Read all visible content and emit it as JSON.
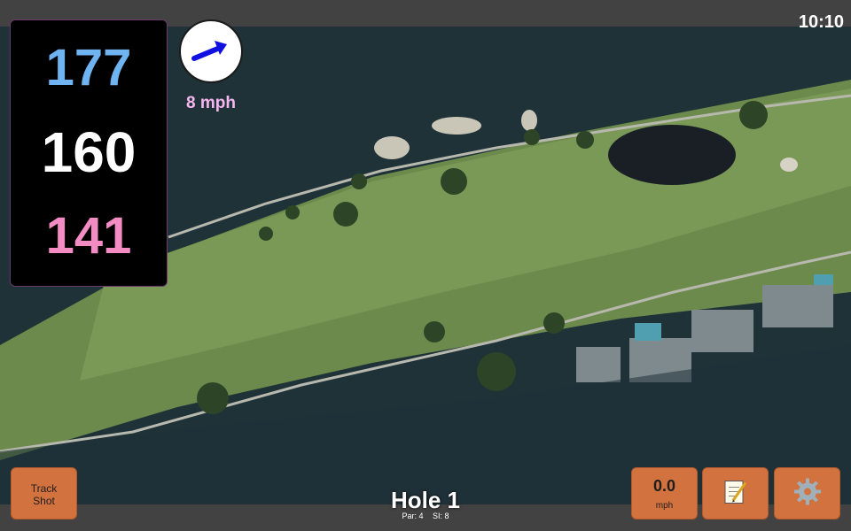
{
  "status": {
    "time": "10:10"
  },
  "distances": {
    "back": "177",
    "middle": "160",
    "front": "141"
  },
  "wind": {
    "speed": "8 mph",
    "direction_icon": "arrow-icon"
  },
  "hole": {
    "title": "Hole 1",
    "par": "Par: 4",
    "stroke_index": "SI: 8"
  },
  "buttons": {
    "track_shot_line1": "Track",
    "track_shot_line2": "Shot",
    "speed_value": "0.0",
    "speed_unit": "mph",
    "notes_icon": "notepad-icon",
    "settings_icon": "gear-icon"
  },
  "colors": {
    "back": "#6fb3f0",
    "middle": "#ffffff",
    "front": "#f48cc4",
    "wind_text": "#f7b6f0",
    "button": "#d2723e",
    "wind_arrow": "#1010e0"
  }
}
